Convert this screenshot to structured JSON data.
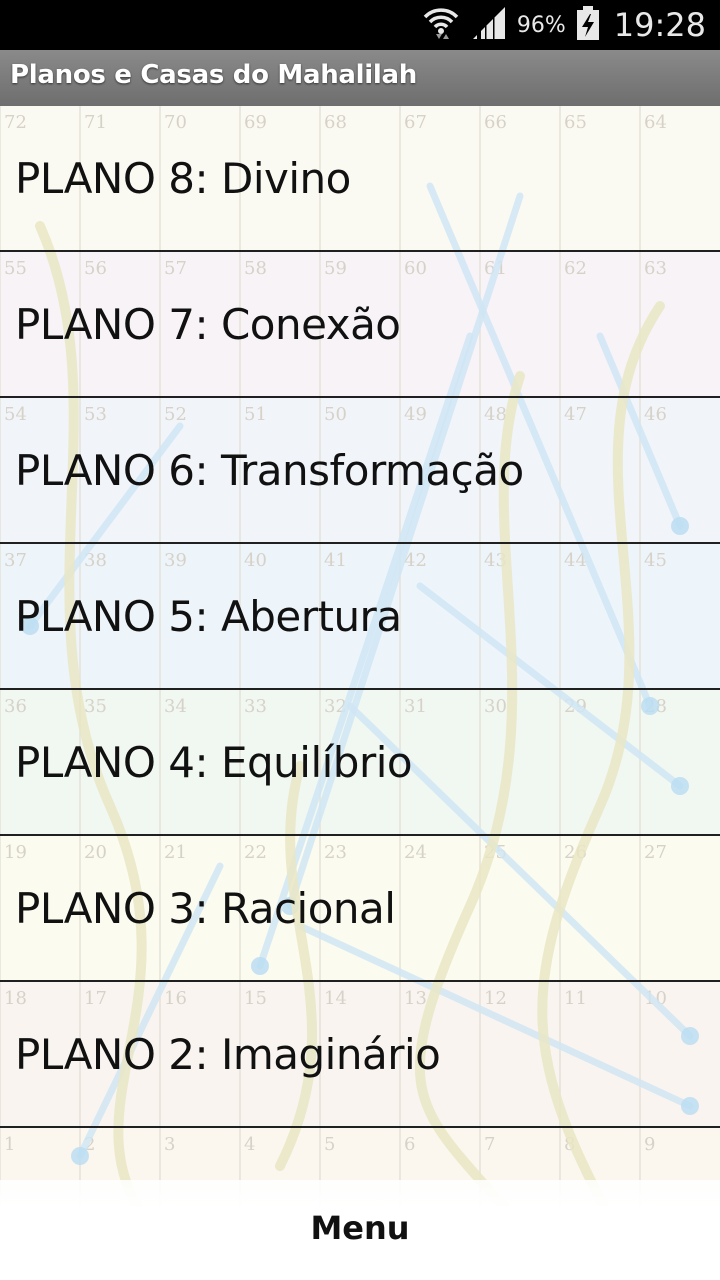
{
  "status_bar": {
    "battery_percent": "96%",
    "time": "19:28",
    "icons": [
      "wifi-icon",
      "signal-icon",
      "battery-charging-icon"
    ]
  },
  "app": {
    "title": "Planos e Casas do Mahalilah"
  },
  "planos": [
    {
      "label": "PLANO 8: Divino"
    },
    {
      "label": "PLANO 7: Conexão"
    },
    {
      "label": "PLANO 6: Transformação"
    },
    {
      "label": "PLANO 5: Abertura"
    },
    {
      "label": "PLANO 4: Equilíbrio"
    },
    {
      "label": "PLANO 3: Racional"
    },
    {
      "label": "PLANO 2: Imaginário"
    }
  ],
  "board_numbers": [
    [
      "72",
      "71",
      "70",
      "69",
      "68",
      "67",
      "66",
      "65",
      "64"
    ],
    [
      "55",
      "56",
      "57",
      "58",
      "59",
      "60",
      "61",
      "62",
      "63"
    ],
    [
      "54",
      "53",
      "52",
      "51",
      "50",
      "49",
      "48",
      "47",
      "46"
    ],
    [
      "37",
      "38",
      "39",
      "40",
      "41",
      "42",
      "43",
      "44",
      "45"
    ],
    [
      "36",
      "35",
      "34",
      "33",
      "32",
      "31",
      "30",
      "29",
      "28"
    ],
    [
      "19",
      "20",
      "21",
      "22",
      "23",
      "24",
      "25",
      "26",
      "27"
    ],
    [
      "18",
      "17",
      "16",
      "15",
      "14",
      "13",
      "12",
      "11",
      "10"
    ],
    [
      "1",
      "2",
      "3",
      "4",
      "5",
      "6",
      "7",
      "8",
      "9"
    ]
  ],
  "row_tints": [
    "#fbfaf2",
    "#f7f3f7",
    "#f1f4f8",
    "#edf4fa",
    "#f1f7f1",
    "#fbfbef",
    "#f9f4ef",
    "#fbf7ef"
  ],
  "menu": {
    "label": "Menu"
  }
}
